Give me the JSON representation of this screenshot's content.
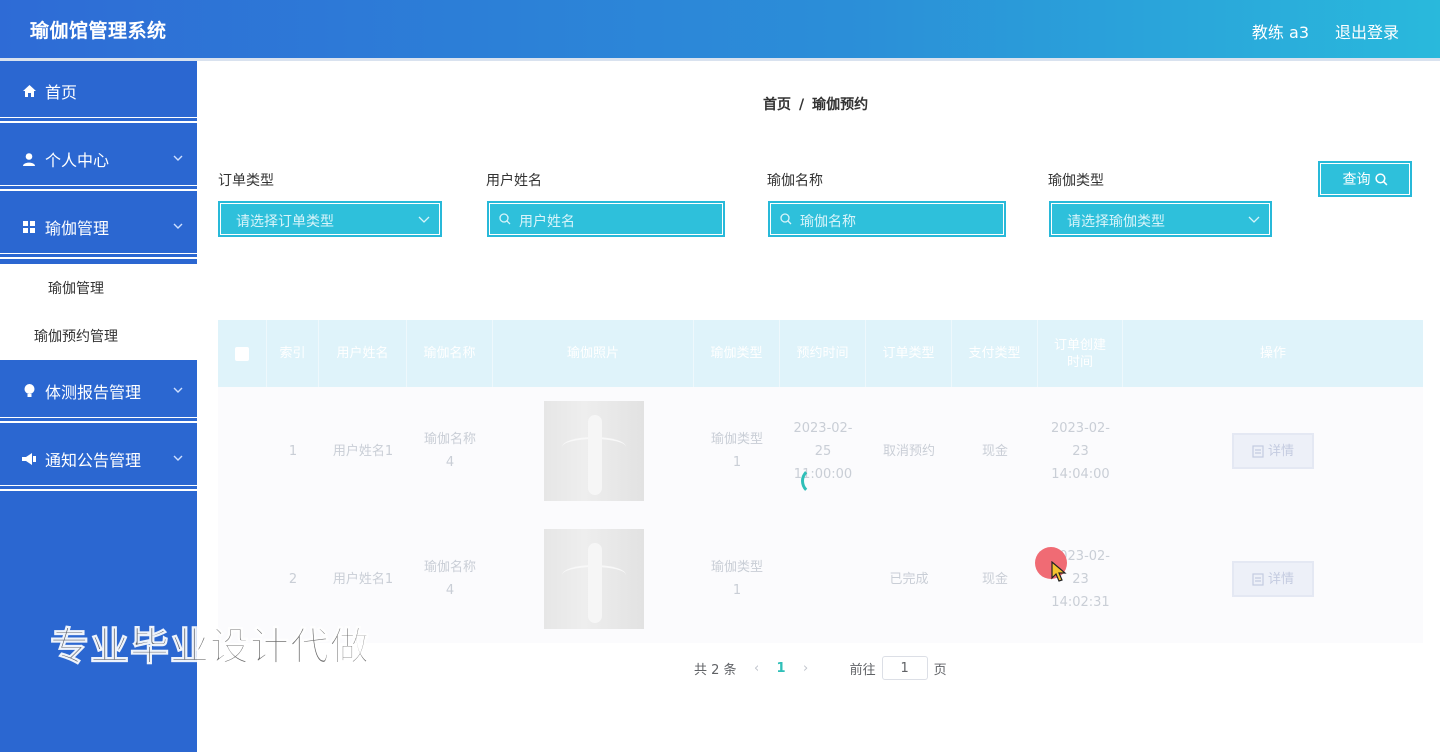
{
  "app": {
    "title": "瑜伽馆管理系统",
    "user": "教练 a3",
    "logout": "退出登录"
  },
  "sidebar": {
    "items": [
      {
        "label": "首页",
        "icon": "home-icon"
      },
      {
        "label": "个人中心",
        "icon": "user-icon"
      },
      {
        "label": "瑜伽管理",
        "icon": "grid-icon"
      },
      {
        "label": "体测报告管理",
        "icon": "bulb-icon"
      },
      {
        "label": "通知公告管理",
        "icon": "megaphone-icon"
      }
    ],
    "subitems": [
      {
        "label": "瑜伽管理"
      },
      {
        "label": "瑜伽预约管理"
      }
    ]
  },
  "breadcrumb": {
    "home": "首页",
    "sep": "/",
    "current": "瑜伽预约"
  },
  "filters": {
    "order_type": {
      "label": "订单类型",
      "placeholder": "请选择订单类型"
    },
    "user_name": {
      "label": "用户姓名",
      "placeholder": "用户姓名"
    },
    "yoga_name": {
      "label": "瑜伽名称",
      "placeholder": "瑜伽名称"
    },
    "yoga_type": {
      "label": "瑜伽类型",
      "placeholder": "请选择瑜伽类型"
    },
    "query": "查询"
  },
  "table": {
    "headers": [
      "索引",
      "用户姓名",
      "瑜伽名称",
      "瑜伽照片",
      "瑜伽类型",
      "预约时间",
      "订单类型",
      "支付类型",
      "订单创建时间",
      "操作"
    ],
    "rows": [
      {
        "index": "1",
        "user": "用户姓名1",
        "yoga_name": "瑜伽名称4",
        "yoga_type": "瑜伽类型1",
        "appoint_time": "2023-02-25 11:00:00",
        "order_type": "取消预约",
        "pay_type": "现金",
        "created": "2023-02-23 14:04:00",
        "action": "详情"
      },
      {
        "index": "2",
        "user": "用户姓名1",
        "yoga_name": "瑜伽名称4",
        "yoga_type": "瑜伽类型1",
        "appoint_time": "",
        "order_type": "已完成",
        "pay_type": "现金",
        "created": "2023-02-23 14:02:31",
        "action": "详情"
      }
    ]
  },
  "pagination": {
    "total": "共 2 条",
    "current": "1",
    "goto": "前往",
    "page_input": "1",
    "page_suffix": "页"
  },
  "watermark": "专业毕业设计代做",
  "colors": {
    "header_start": "#2e6bd6",
    "header_end": "#29b9dc",
    "sidebar": "#2b67d1",
    "accent": "#2ec0db"
  }
}
